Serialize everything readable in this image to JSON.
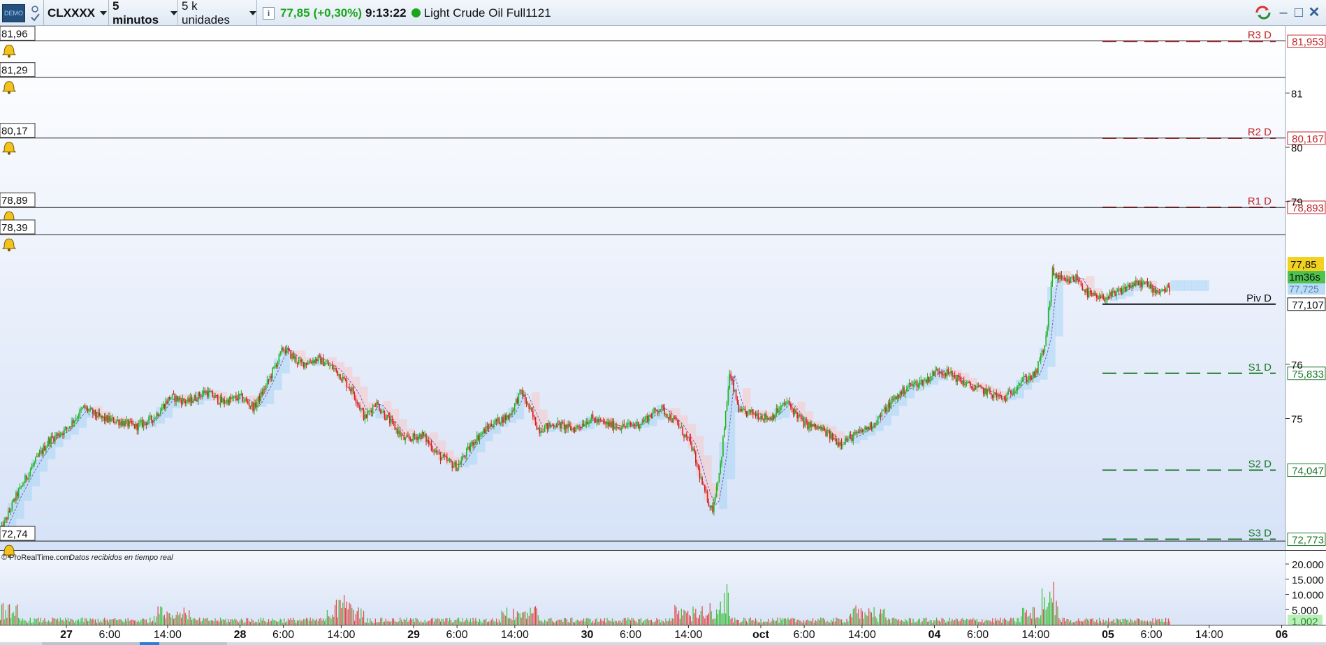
{
  "toolbar": {
    "demo_badge": "DEMO",
    "symbol": "CLXXXX",
    "timeframe": "5 minutos",
    "units": "5 k unidades",
    "info_icon": "info-icon",
    "price": "77,85",
    "change": "(+0,30%)",
    "time": "9:13:22",
    "instrument": "Light Crude Oil Full1121",
    "status_color": "#1aa51a",
    "price_color": "#1aa51a"
  },
  "alerts": [
    {
      "label": "81,96",
      "price": 81.96
    },
    {
      "label": "81,29",
      "price": 81.29
    },
    {
      "label": "80,17",
      "price": 80.17
    },
    {
      "label": "78,89",
      "price": 78.89
    },
    {
      "label": "78,39",
      "price": 78.39
    },
    {
      "label": "72,74",
      "price": 72.74
    }
  ],
  "pivots": [
    {
      "name": "R3 D",
      "value": 81.953,
      "label": "81,953",
      "color": "#c0282d",
      "style": "dashed"
    },
    {
      "name": "R2 D",
      "value": 80.167,
      "label": "80,167",
      "color": "#c0282d",
      "style": "dashed"
    },
    {
      "name": "R1 D",
      "value": 78.893,
      "label": "78,893",
      "color": "#c0282d",
      "style": "dashed"
    },
    {
      "name": "Piv D",
      "value": 77.107,
      "label": "77,107",
      "color": "#111111",
      "style": "solid"
    },
    {
      "name": "S1 D",
      "value": 75.833,
      "label": "75,833",
      "color": "#1e7a2c",
      "style": "dashed"
    },
    {
      "name": "S2 D",
      "value": 74.047,
      "label": "74,047",
      "color": "#1e7a2c",
      "style": "dashed"
    },
    {
      "name": "S3 D",
      "value": 72.773,
      "label": "72,773",
      "color": "#1e7a2c",
      "style": "dashed"
    }
  ],
  "price_axis": {
    "ticks": [
      {
        "value": 81,
        "label": "81"
      },
      {
        "value": 80,
        "label": "80"
      },
      {
        "value": 79,
        "label": "79"
      },
      {
        "value": 76,
        "label": "76"
      },
      {
        "value": 75,
        "label": "75"
      }
    ]
  },
  "price_tags": {
    "last": {
      "label": "77,85",
      "value": 77.85,
      "color": "#f2d21e"
    },
    "countdown": {
      "label": "1m36s",
      "color": "#4ec24e"
    },
    "cloud": {
      "label": "77,725",
      "value": 77.725,
      "color": "#b9dcf7"
    }
  },
  "footer_credit": {
    "brand": "© ProRealTime.com",
    "note": "Datos recibidos en tiempo real"
  },
  "volume_axis": {
    "ticks": [
      {
        "value": 20000,
        "label": "20.000"
      },
      {
        "value": 15000,
        "label": "15.000"
      },
      {
        "value": 10000,
        "label": "10.000"
      },
      {
        "value": 5000,
        "label": "5.000"
      }
    ],
    "last_label": "1.002"
  },
  "time_axis": {
    "labels": [
      {
        "t": 0.0,
        "label": "27",
        "bold": true
      },
      {
        "t": 0.25,
        "label": "6:00",
        "bold": false
      },
      {
        "t": 0.583,
        "label": "14:00",
        "bold": false
      },
      {
        "t": 1.0,
        "label": "28",
        "bold": true
      },
      {
        "t": 1.25,
        "label": "6:00",
        "bold": false
      },
      {
        "t": 1.583,
        "label": "14:00",
        "bold": false
      },
      {
        "t": 2.0,
        "label": "29",
        "bold": true
      },
      {
        "t": 2.25,
        "label": "6:00",
        "bold": false
      },
      {
        "t": 2.583,
        "label": "14:00",
        "bold": false
      },
      {
        "t": 3.0,
        "label": "30",
        "bold": true
      },
      {
        "t": 3.25,
        "label": "6:00",
        "bold": false
      },
      {
        "t": 3.583,
        "label": "14:00",
        "bold": false
      },
      {
        "t": 4.0,
        "label": "oct",
        "bold": true
      },
      {
        "t": 4.25,
        "label": "6:00",
        "bold": false
      },
      {
        "t": 4.583,
        "label": "14:00",
        "bold": false
      },
      {
        "t": 5.0,
        "label": "04",
        "bold": true
      },
      {
        "t": 5.25,
        "label": "6:00",
        "bold": false
      },
      {
        "t": 5.583,
        "label": "14:00",
        "bold": false
      },
      {
        "t": 6.0,
        "label": "05",
        "bold": true
      },
      {
        "t": 6.25,
        "label": "6:00",
        "bold": false
      },
      {
        "t": 6.583,
        "label": "14:00",
        "bold": false
      },
      {
        "t": 7.0,
        "label": "06",
        "bold": true
      }
    ]
  },
  "chart_data": {
    "type": "line",
    "title": "",
    "y_range": [
      72.6,
      82.2
    ],
    "price_path": [
      [
        -0.38,
        72.9
      ],
      [
        -0.3,
        73.5
      ],
      [
        -0.2,
        74.1
      ],
      [
        -0.1,
        74.6
      ],
      [
        0.0,
        74.8
      ],
      [
        0.1,
        75.2
      ],
      [
        0.2,
        75.0
      ],
      [
        0.3,
        74.95
      ],
      [
        0.4,
        74.85
      ],
      [
        0.5,
        75.0
      ],
      [
        0.6,
        75.4
      ],
      [
        0.7,
        75.3
      ],
      [
        0.8,
        75.5
      ],
      [
        0.9,
        75.3
      ],
      [
        1.0,
        75.4
      ],
      [
        1.08,
        75.2
      ],
      [
        1.15,
        75.6
      ],
      [
        1.25,
        76.3
      ],
      [
        1.35,
        76.0
      ],
      [
        1.45,
        76.1
      ],
      [
        1.55,
        75.9
      ],
      [
        1.65,
        75.5
      ],
      [
        1.72,
        75.0
      ],
      [
        1.78,
        75.3
      ],
      [
        1.85,
        75.0
      ],
      [
        1.95,
        74.6
      ],
      [
        2.05,
        74.7
      ],
      [
        2.15,
        74.3
      ],
      [
        2.25,
        74.1
      ],
      [
        2.35,
        74.6
      ],
      [
        2.45,
        74.9
      ],
      [
        2.55,
        75.05
      ],
      [
        2.62,
        75.5
      ],
      [
        2.72,
        74.8
      ],
      [
        2.82,
        74.9
      ],
      [
        2.92,
        74.8
      ],
      [
        3.02,
        75.0
      ],
      [
        3.1,
        74.9
      ],
      [
        3.2,
        74.85
      ],
      [
        3.3,
        74.9
      ],
      [
        3.42,
        75.2
      ],
      [
        3.52,
        74.9
      ],
      [
        3.6,
        74.5
      ],
      [
        3.67,
        73.7
      ],
      [
        3.72,
        73.3
      ],
      [
        3.77,
        74.2
      ],
      [
        3.82,
        75.8
      ],
      [
        3.88,
        75.1
      ],
      [
        3.95,
        75.1
      ],
      [
        4.05,
        75.0
      ],
      [
        4.15,
        75.3
      ],
      [
        4.25,
        74.9
      ],
      [
        4.35,
        74.8
      ],
      [
        4.45,
        74.55
      ],
      [
        4.55,
        74.7
      ],
      [
        4.65,
        74.9
      ],
      [
        4.75,
        75.3
      ],
      [
        4.85,
        75.6
      ],
      [
        4.95,
        75.7
      ],
      [
        5.02,
        75.9
      ],
      [
        5.1,
        75.8
      ],
      [
        5.2,
        75.6
      ],
      [
        5.3,
        75.5
      ],
      [
        5.4,
        75.35
      ],
      [
        5.5,
        75.7
      ],
      [
        5.58,
        75.8
      ],
      [
        5.64,
        76.4
      ],
      [
        5.68,
        77.7
      ],
      [
        5.75,
        77.5
      ],
      [
        5.82,
        77.6
      ],
      [
        5.88,
        77.3
      ],
      [
        5.95,
        77.2
      ],
      [
        6.05,
        77.3
      ],
      [
        6.12,
        77.45
      ],
      [
        6.2,
        77.5
      ],
      [
        6.28,
        77.35
      ],
      [
        6.36,
        77.4
      ]
    ],
    "volume": {
      "ymax": 20000,
      "last": 1002
    }
  }
}
